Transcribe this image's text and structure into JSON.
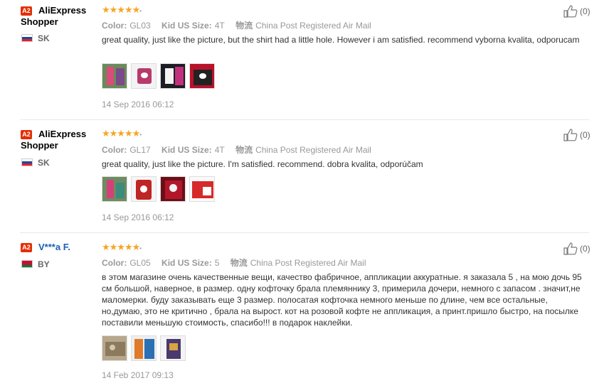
{
  "reviews": [
    {
      "badge": "A2",
      "user_line1": "AliExpress",
      "user_line2": "Shopper",
      "country": "SK",
      "color_label": "Color:",
      "color_value": "GL03",
      "size_label": "Kid US Size:",
      "size_value": "4T",
      "shipping_label": "物流",
      "shipping_value": "China Post Registered Air Mail",
      "text": "great quality, just like the picture, but the shirt had a little hole. However i am satisfied. recommend vyborna kvalita, odporucam",
      "date": "14 Sep 2016 06:12",
      "likes": "(0)",
      "rating": 5
    },
    {
      "badge": "A2",
      "user_line1": "AliExpress",
      "user_line2": "Shopper",
      "country": "SK",
      "color_label": "Color:",
      "color_value": "GL17",
      "size_label": "Kid US Size:",
      "size_value": "4T",
      "shipping_label": "物流",
      "shipping_value": "China Post Registered Air Mail",
      "text": "great quality, just like the picture. I'm satisfied. recommend. dobra kvalita, odporúčam",
      "date": "14 Sep 2016 06:12",
      "likes": "(0)",
      "rating": 5
    },
    {
      "badge": "A2",
      "user_line1": "V***a F.",
      "country": "BY",
      "color_label": "Color:",
      "color_value": "GL05",
      "size_label": "Kid US Size:",
      "size_value": "5",
      "shipping_label": "物流",
      "shipping_value": "China Post Registered Air Mail",
      "text": "в этом магазине очень качественные вещи, качество фабричное, аппликации аккуратные. я заказала 5 , на мою дочь 95 см большой, наверное, в размер. одну кофточку брала племяннику 3, примерила дочери, немного с запасом . значит,не маломерки. буду заказывать еще 3 размер. полосатая кофточка немного меньше по длине, чем все остальные, но,думаю, это не критично , брала на вырост. кот на розовой кофте не аппликация, а принт.пришло быстро, на посылке поставили меньшую стоимость, спасибо!!! в подарок наклейки.",
      "date": "14 Feb 2017 09:13",
      "likes": "(0)",
      "rating": 5
    }
  ],
  "colors": {
    "star": "#f5a623",
    "badge": "#e62e04",
    "username_link": "#1a5fb4"
  }
}
